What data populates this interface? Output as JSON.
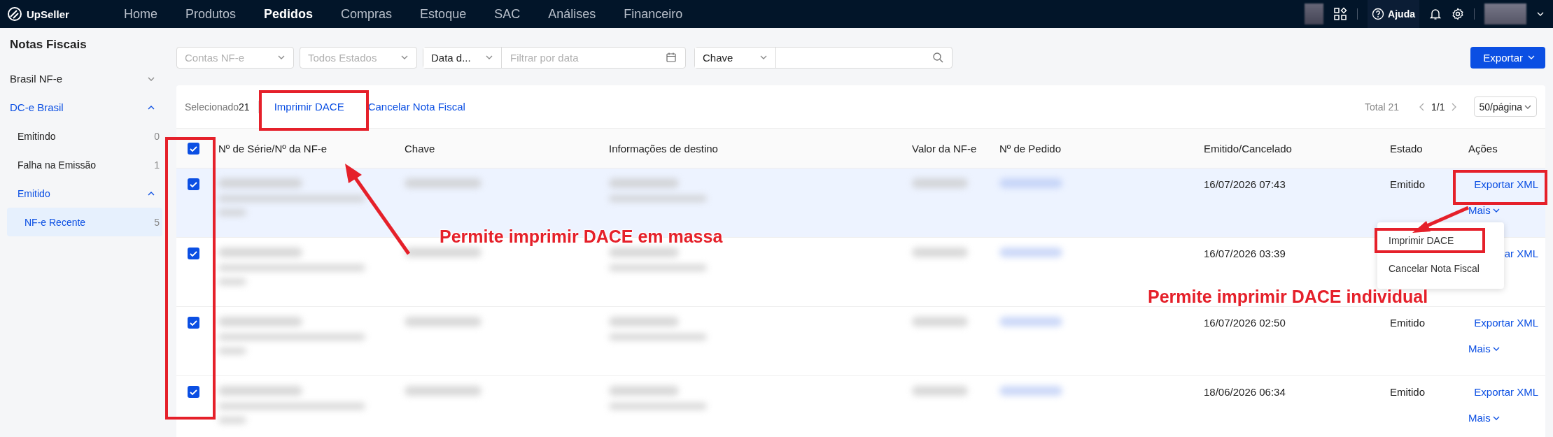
{
  "top_nav": {
    "logo": "UpSeller",
    "items": [
      {
        "label": "Home",
        "selected": false
      },
      {
        "label": "Produtos",
        "selected": false
      },
      {
        "label": "Pedidos",
        "selected": true
      },
      {
        "label": "Compras",
        "selected": false
      },
      {
        "label": "Estoque",
        "selected": false
      },
      {
        "label": "SAC",
        "selected": false
      },
      {
        "label": "Análises",
        "selected": false
      },
      {
        "label": "Financeiro",
        "selected": false
      }
    ],
    "help": "Ajuda"
  },
  "sidebar": {
    "title": "Notas Fiscais",
    "items": [
      {
        "label": "Brasil NF-e",
        "expanded": false
      },
      {
        "label": "DC-e Brasil",
        "expanded": true,
        "children": [
          {
            "label": "Emitindo",
            "count": "0",
            "selected": false
          },
          {
            "label": "Falha na Emissão",
            "count": "1",
            "selected": false
          },
          {
            "label": "Emitido",
            "expanded": true,
            "children": [
              {
                "label": "NF-e Recente",
                "count": "5",
                "selected": true
              }
            ]
          }
        ]
      }
    ]
  },
  "filters": [
    {
      "kind": "select",
      "placeholder": "Contas NF-e"
    },
    {
      "kind": "select",
      "placeholder": "Todos Estados"
    },
    {
      "kind": "date",
      "value": "Data d...",
      "placeholder": "Filtrar por data"
    },
    {
      "kind": "search",
      "value": "Chave"
    }
  ],
  "export_button": "Exportar",
  "toolbar": {
    "selected_label": "Selecionado",
    "selected_count": "21",
    "actions": [
      "Imprimir DACE",
      "Cancelar Nota Fiscal"
    ],
    "total": "Total 21",
    "page": "1/1",
    "page_size": "50/página"
  },
  "table": {
    "all_checked": true,
    "columns": [
      "Nº de Série/Nº da NF-e",
      "Chave",
      "Informações de destino",
      "Valor da NF-e",
      "Nº de Pedido",
      "Emitido/Cancelado",
      "Estado",
      "Ações"
    ],
    "rows": [
      {
        "checked": true,
        "hovered": true,
        "issued": "16/07/2026 07:43",
        "state": "Emitido",
        "export": "Exportar XML",
        "more": "Mais"
      },
      {
        "checked": true,
        "hovered": false,
        "issued": "16/07/2026 03:39",
        "export": "ar XML"
      },
      {
        "checked": true,
        "hovered": false,
        "issued": "16/07/2026 02:50",
        "state": "Emitido",
        "export": "Exportar XML",
        "more": "Mais"
      },
      {
        "checked": true,
        "hovered": false,
        "issued": "18/06/2026 06:34",
        "state": "Emitido",
        "export": "Exportar XML",
        "more": "Mais"
      }
    ]
  },
  "dropdown_menu": {
    "items": [
      "Imprimir DACE",
      "Cancelar Nota Fiscal"
    ]
  },
  "annotations": [
    {
      "text": "Permite imprimir DACE em massa"
    },
    {
      "text": "Permite imprimir DACE individual"
    }
  ]
}
